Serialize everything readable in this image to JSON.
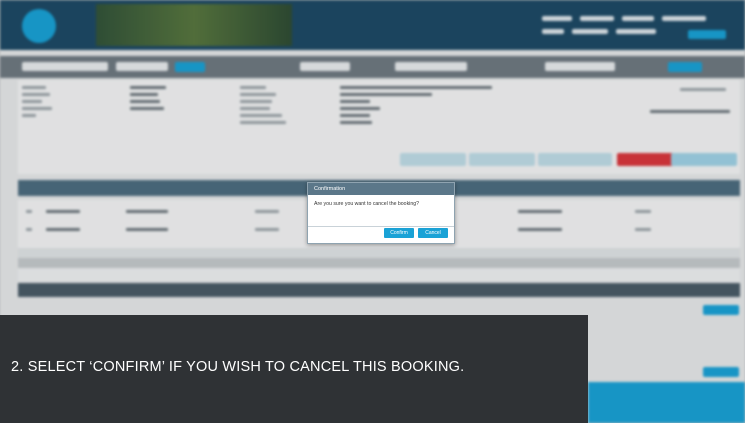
{
  "dialog": {
    "title": "Confirmation",
    "message": "Are you sure you want to cancel the booking?",
    "confirm_label": "Confirm",
    "cancel_label": "Cancel"
  },
  "caption": {
    "text": "2. SELECT ‘CONFIRM’ IF YOU WISH TO CANCEL THIS BOOKING."
  },
  "colors": {
    "header": "#1e4a66",
    "accent": "#1aa2d6",
    "dialog_header": "#5b7789",
    "caption_bg": "#2f3235",
    "cancel_button_red": "#d9373d"
  }
}
